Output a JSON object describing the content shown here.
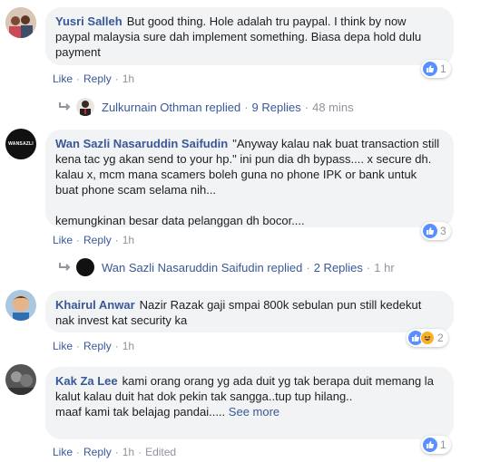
{
  "comments": [
    {
      "author": "Yusri Salleh",
      "text": "But good thing. Hole adalah tru paypal. I think by now paypal malaysia sure dah implement something. Biasa depa hold dulu payment",
      "like": "Like",
      "reply": "Reply",
      "time": "1h",
      "reaction_count": "1",
      "replies": {
        "replier": "Zulkurnain Othman replied",
        "count": "9 Replies",
        "time": "48 mins"
      }
    },
    {
      "author": "Wan Sazli Nasaruddin Saifudin",
      "avatar_text": "WANSAZLI",
      "text": "\"Anyway kalau nak buat transaction still kena tac yg akan send to your hp.\" ini pun dia dh bypass.... x secure dh. kalau x, mcm mana scamers boleh guna no phone IPK or bank untuk buat phone scam selama nih...",
      "text2": "kemungkinan besar data pelanggan dh bocor....",
      "like": "Like",
      "reply": "Reply",
      "time": "1h",
      "reaction_count": "3",
      "replies": {
        "replier": "Wan Sazli Nasaruddin Saifudin replied",
        "count": "2 Replies",
        "time": "1 hr"
      }
    },
    {
      "author": "Khairul Anwar",
      "text": "Nazir Razak gaji smpai 800k sebulan pun still kedekut nak invest kat security ka",
      "like": "Like",
      "reply": "Reply",
      "time": "1h",
      "reaction_count": "2"
    },
    {
      "author": "Kak Za Lee",
      "text": "kami orang orang yg ada duit yg tak berapa duit memang la kalut kalau duit hat dok pekin tak sangga..tup tup hilang..",
      "text2": "maaf kami tak belajag pandai.....",
      "see_more": "See more",
      "like": "Like",
      "reply": "Reply",
      "time": "1h",
      "edited": "Edited",
      "reaction_count": "1"
    }
  ],
  "colors": {
    "link": "#385898",
    "bubble": "#f2f3f5",
    "meta": "#90949c",
    "like_blue": "#5890ff",
    "haha_yellow": "#f7b125"
  },
  "icons": [
    "like-icon",
    "haha-icon",
    "reply-arrow-icon"
  ]
}
